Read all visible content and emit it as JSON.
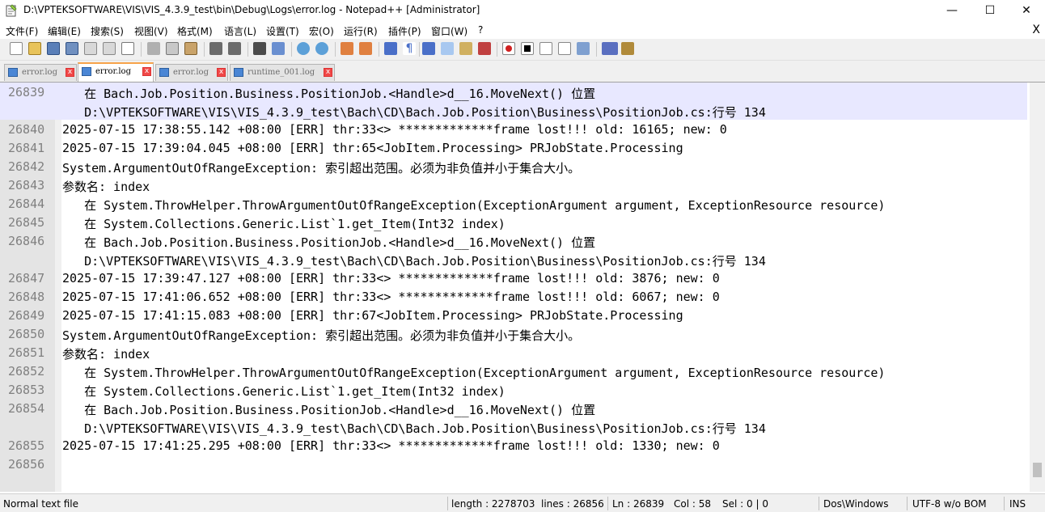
{
  "window": {
    "title": "D:\\VPTEKSOFTWARE\\VIS\\VIS_4.3.9_test\\bin\\Debug\\Logs\\error.log - Notepad++ [Administrator]",
    "minimize_glyph": "—",
    "maximize_glyph": "☐",
    "close_glyph": "✕"
  },
  "menu": {
    "items": [
      "文件(F)",
      "编辑(E)",
      "搜索(S)",
      "视图(V)",
      "格式(M)",
      "语言(L)",
      "设置(T)",
      "宏(O)",
      "运行(R)",
      "插件(P)",
      "窗口(W)",
      "?"
    ],
    "close_glyph": "X"
  },
  "tabs": [
    {
      "label": "error.log",
      "active": false
    },
    {
      "label": "error.log",
      "active": true
    },
    {
      "label": "error.log",
      "active": false
    },
    {
      "label": "runtime_001.log",
      "active": false
    }
  ],
  "tab_close_glyph": "x",
  "editor": {
    "lines": [
      {
        "num": "26839",
        "text": "   在 Bach.Job.Position.Business.PositionJob.<Handle>d__16.MoveNext() 位置",
        "current": true
      },
      {
        "num": "",
        "text": "   D:\\VPTEKSOFTWARE\\VIS\\VIS_4.3.9_test\\Bach\\CD\\Bach.Job.Position\\Business\\PositionJob.cs:行号 134",
        "current": true
      },
      {
        "num": "26840",
        "text": "2025-07-15 17:38:55.142 +08:00 [ERR] thr:33<> *************frame lost!!! old: 16165; new: 0"
      },
      {
        "num": "26841",
        "text": "2025-07-15 17:39:04.045 +08:00 [ERR] thr:65<JobItem.Processing> PRJobState.Processing"
      },
      {
        "num": "26842",
        "text": "System.ArgumentOutOfRangeException: 索引超出范围。必须为非负值并小于集合大小。"
      },
      {
        "num": "26843",
        "text": "参数名: index"
      },
      {
        "num": "26844",
        "text": "   在 System.ThrowHelper.ThrowArgumentOutOfRangeException(ExceptionArgument argument, ExceptionResource resource)"
      },
      {
        "num": "26845",
        "text": "   在 System.Collections.Generic.List`1.get_Item(Int32 index)"
      },
      {
        "num": "26846",
        "text": "   在 Bach.Job.Position.Business.PositionJob.<Handle>d__16.MoveNext() 位置"
      },
      {
        "num": "",
        "text": "   D:\\VPTEKSOFTWARE\\VIS\\VIS_4.3.9_test\\Bach\\CD\\Bach.Job.Position\\Business\\PositionJob.cs:行号 134"
      },
      {
        "num": "26847",
        "text": "2025-07-15 17:39:47.127 +08:00 [ERR] thr:33<> *************frame lost!!! old: 3876; new: 0"
      },
      {
        "num": "26848",
        "text": "2025-07-15 17:41:06.652 +08:00 [ERR] thr:33<> *************frame lost!!! old: 6067; new: 0"
      },
      {
        "num": "26849",
        "text": "2025-07-15 17:41:15.083 +08:00 [ERR] thr:67<JobItem.Processing> PRJobState.Processing"
      },
      {
        "num": "26850",
        "text": "System.ArgumentOutOfRangeException: 索引超出范围。必须为非负值并小于集合大小。"
      },
      {
        "num": "26851",
        "text": "参数名: index"
      },
      {
        "num": "26852",
        "text": "   在 System.ThrowHelper.ThrowArgumentOutOfRangeException(ExceptionArgument argument, ExceptionResource resource)"
      },
      {
        "num": "26853",
        "text": "   在 System.Collections.Generic.List`1.get_Item(Int32 index)"
      },
      {
        "num": "26854",
        "text": "   在 Bach.Job.Position.Business.PositionJob.<Handle>d__16.MoveNext() 位置"
      },
      {
        "num": "",
        "text": "   D:\\VPTEKSOFTWARE\\VIS\\VIS_4.3.9_test\\Bach\\CD\\Bach.Job.Position\\Business\\PositionJob.cs:行号 134"
      },
      {
        "num": "26855",
        "text": "2025-07-15 17:41:25.295 +08:00 [ERR] thr:33<> *************frame lost!!! old: 1330; new: 0"
      },
      {
        "num": "26856",
        "text": ""
      }
    ]
  },
  "status": {
    "file_type": "Normal text file",
    "length": "length : 2278703",
    "lines": "lines : 26856",
    "ln": "Ln : 26839",
    "col": "Col : 58",
    "sel": "Sel : 0 | 0",
    "eol": "Dos\\Windows",
    "encoding": "UTF-8 w/o BOM",
    "mode": "INS"
  },
  "colors": {
    "current_line": "#e8e8ff",
    "active_tab_accent": "#f7a34a",
    "gutter": "#e4e4e4"
  }
}
